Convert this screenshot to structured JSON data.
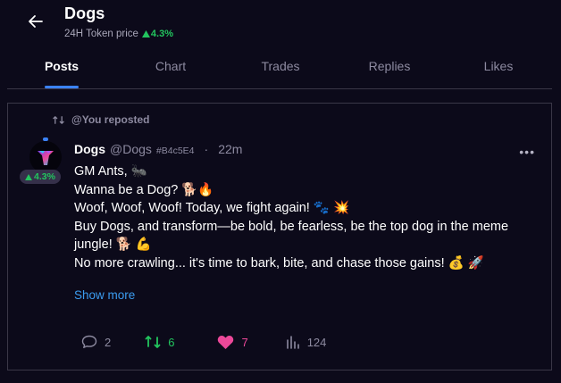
{
  "header": {
    "title": "Dogs",
    "subtitle_label": "24H Token price",
    "price_change": "4.3%"
  },
  "tabs": [
    {
      "label": "Posts",
      "active": true
    },
    {
      "label": "Chart",
      "active": false
    },
    {
      "label": "Trades",
      "active": false
    },
    {
      "label": "Replies",
      "active": false
    },
    {
      "label": "Likes",
      "active": false
    }
  ],
  "post": {
    "repost_text": "@You reposted",
    "author": "Dogs",
    "handle": "@Dogs",
    "address": "#B4c5E4",
    "separator": "·",
    "time": "22m",
    "avatar_badge": "4.3%",
    "lines": [
      "GM Ants, 🐜",
      "Wanna be a Dog? 🐕🔥",
      "Woof, Woof, Woof! Today, we fight again! 🐾 💥",
      "Buy Dogs, and transform—be bold, be fearless, be the top dog in the meme jungle! 🐕 💪",
      "No more crawling... it's time to bark, bite, and chase those gains! 💰 🚀"
    ],
    "show_more": "Show more",
    "stats": {
      "replies": "2",
      "reposts": "6",
      "likes": "7",
      "views": "124"
    }
  },
  "colors": {
    "background": "#0c0a1a",
    "accent": "#3b82f6",
    "positive": "#22c55e",
    "like": "#ec4899",
    "muted": "#8d8aa0"
  }
}
